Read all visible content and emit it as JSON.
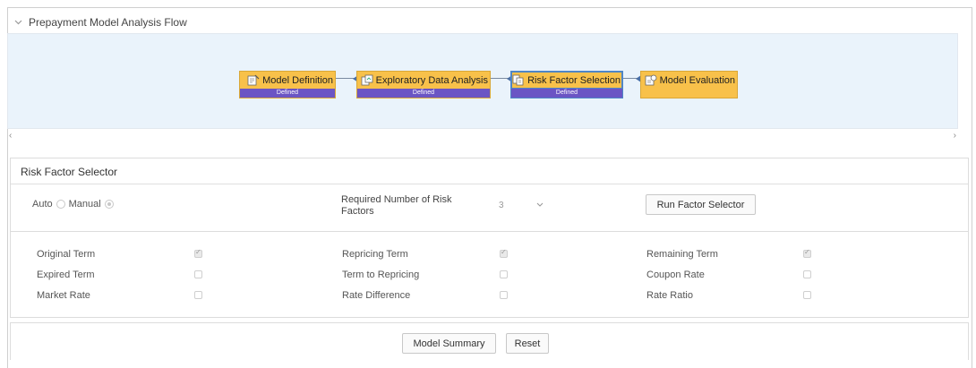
{
  "flow": {
    "title": "Prepayment Model Analysis Flow",
    "collapse_icon": "chevron-down-icon",
    "nodes": [
      {
        "label": "Model Definition",
        "status": "Defined",
        "icon": "document-edit-icon"
      },
      {
        "label": "Exploratory Data Analysis",
        "status": "Defined",
        "icon": "analysis-icon"
      },
      {
        "label": "Risk Factor Selection",
        "status": "Defined",
        "icon": "factor-icon"
      },
      {
        "label": "Model Evaluation",
        "status": "",
        "icon": "evaluation-icon"
      }
    ],
    "scroll_left": "‹",
    "scroll_right": "›",
    "colors": {
      "node_fill": "#f8c14a",
      "status_fill": "#6b55c4",
      "canvas_bg": "#eaf3fb"
    }
  },
  "selector": {
    "title": "Risk Factor Selector",
    "auto_label": "Auto",
    "manual_label": "Manual",
    "selected_mode": "Manual",
    "required_label": "Required Number of Risk Factors",
    "required_value": "3",
    "dropdown_icon": "chevron-down-icon",
    "run_button": "Run Factor Selector"
  },
  "factors": [
    {
      "label": "Original Term",
      "checked": true
    },
    {
      "label": "Repricing Term",
      "checked": true
    },
    {
      "label": "Remaining Term",
      "checked": true
    },
    {
      "label": "Expired Term",
      "checked": false
    },
    {
      "label": "Term to Repricing",
      "checked": false
    },
    {
      "label": "Coupon Rate",
      "checked": false
    },
    {
      "label": "Market Rate",
      "checked": false
    },
    {
      "label": "Rate Difference",
      "checked": false
    },
    {
      "label": "Rate Ratio",
      "checked": false
    }
  ],
  "footer": {
    "model_summary": "Model Summary",
    "reset": "Reset"
  }
}
